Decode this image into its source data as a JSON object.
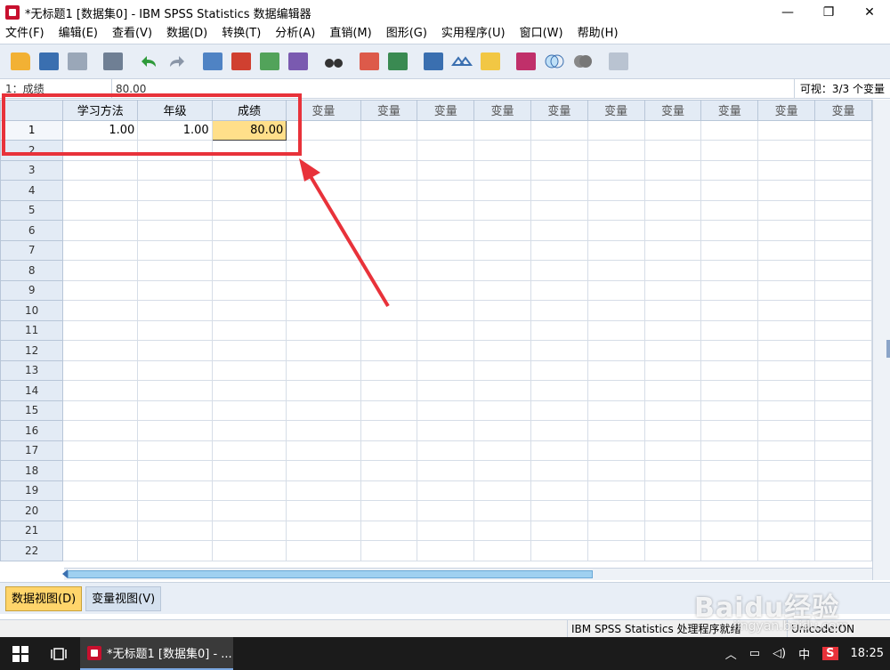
{
  "window": {
    "title": "*无标题1 [数据集0] - IBM SPSS Statistics 数据编辑器",
    "minimize": "—",
    "restore": "❐",
    "close": "✕"
  },
  "menu": [
    {
      "label": "文件(F)"
    },
    {
      "label": "编辑(E)"
    },
    {
      "label": "查看(V)"
    },
    {
      "label": "数据(D)"
    },
    {
      "label": "转换(T)"
    },
    {
      "label": "分析(A)"
    },
    {
      "label": "直销(M)"
    },
    {
      "label": "图形(G)"
    },
    {
      "label": "实用程序(U)"
    },
    {
      "label": "窗口(W)"
    },
    {
      "label": "帮助(H)"
    }
  ],
  "toolbar": {
    "icons": [
      "open-icon",
      "save-icon",
      "print-icon",
      "dialog-recall-icon",
      "undo-icon",
      "redo-icon",
      "goto-case-icon",
      "goto-variable-icon",
      "variables-icon",
      "run-descriptives-icon",
      "find-icon",
      "insert-cases-icon",
      "insert-variable-icon",
      "split-file-icon",
      "weight-cases-icon",
      "select-cases-icon",
      "value-labels-icon",
      "use-sets-icon",
      "show-all-icon",
      "spell-check-icon"
    ],
    "colors": {
      "accent": "#3a6fb0",
      "undo": "#2e9a3a"
    }
  },
  "refbar": {
    "cell_ref": "1：成绩",
    "cell_value": "80.00",
    "visible": "可视：3/3 个变量"
  },
  "grid": {
    "columns": [
      "学习方法",
      "年级",
      "成绩",
      "变量",
      "变量",
      "变量",
      "变量",
      "变量",
      "变量",
      "变量",
      "变量",
      "变量",
      "变量"
    ],
    "rows": [
      {
        "num": "1",
        "cells": [
          "1.00",
          "1.00",
          "80.00",
          "",
          "",
          "",
          "",
          "",
          "",
          "",
          "",
          "",
          ""
        ]
      },
      {
        "num": "2"
      },
      {
        "num": "3"
      },
      {
        "num": "4"
      },
      {
        "num": "5"
      },
      {
        "num": "6"
      },
      {
        "num": "7"
      },
      {
        "num": "8"
      },
      {
        "num": "9"
      },
      {
        "num": "10"
      },
      {
        "num": "11"
      },
      {
        "num": "12"
      },
      {
        "num": "13"
      },
      {
        "num": "14"
      },
      {
        "num": "15"
      },
      {
        "num": "16"
      },
      {
        "num": "17"
      },
      {
        "num": "18"
      },
      {
        "num": "19"
      },
      {
        "num": "20"
      },
      {
        "num": "21"
      },
      {
        "num": "22"
      }
    ],
    "selected_color": "#ffdf8a"
  },
  "viewtabs": {
    "data_view": "数据视图(D)",
    "variable_view": "变量视图(V)"
  },
  "status": {
    "processor": "IBM SPSS Statistics 处理程序就绪",
    "unicode": "Unicode:ON"
  },
  "taskbar": {
    "app_label": "*无标题1 [数据集0] - ...",
    "ime": "中",
    "ime_brand": "S",
    "clock": "18:25"
  },
  "annotation": {
    "color": "#e8323a"
  },
  "watermark": {
    "main": "Baidu经验",
    "sub": "jingyan.baidu.com"
  }
}
